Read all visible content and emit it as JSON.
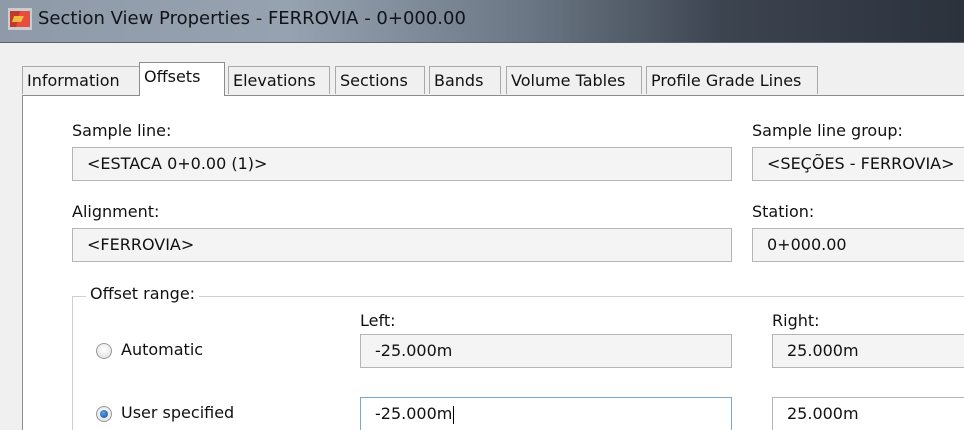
{
  "window": {
    "title": "Section View Properties - FERROVIA - 0+000.00",
    "icon": "civil3d-app-icon",
    "colors": {
      "title_gradient_start": "#8f9aa8",
      "title_gradient_end": "#2b323c",
      "focus_border": "#7aa6d6",
      "radio_selected": "#1f5fa8"
    }
  },
  "tabs": [
    {
      "label": "Information",
      "active": false
    },
    {
      "label": "Offsets",
      "active": true
    },
    {
      "label": "Elevations",
      "active": false
    },
    {
      "label": "Sections",
      "active": false
    },
    {
      "label": "Bands",
      "active": false
    },
    {
      "label": "Volume Tables",
      "active": false
    },
    {
      "label": "Profile Grade Lines",
      "active": false
    }
  ],
  "sample_line": {
    "label": "Sample line:",
    "value": "<ESTACA 0+0.00 (1)>"
  },
  "sample_line_group": {
    "label": "Sample line group:",
    "value": "<SEÇÕES - FERROVIA>"
  },
  "alignment": {
    "label": "Alignment:",
    "value": "<FERROVIA>"
  },
  "station": {
    "label": "Station:",
    "value": "0+000.00"
  },
  "offset_range": {
    "title": "Offset range:",
    "left_label": "Left:",
    "right_label": "Right:",
    "automatic": {
      "label": "Automatic",
      "selected": false,
      "left": "-25.000m",
      "right": "25.000m"
    },
    "user_specified": {
      "label": "User specified",
      "selected": true,
      "left": "-25.000m",
      "right": "25.000m"
    }
  }
}
